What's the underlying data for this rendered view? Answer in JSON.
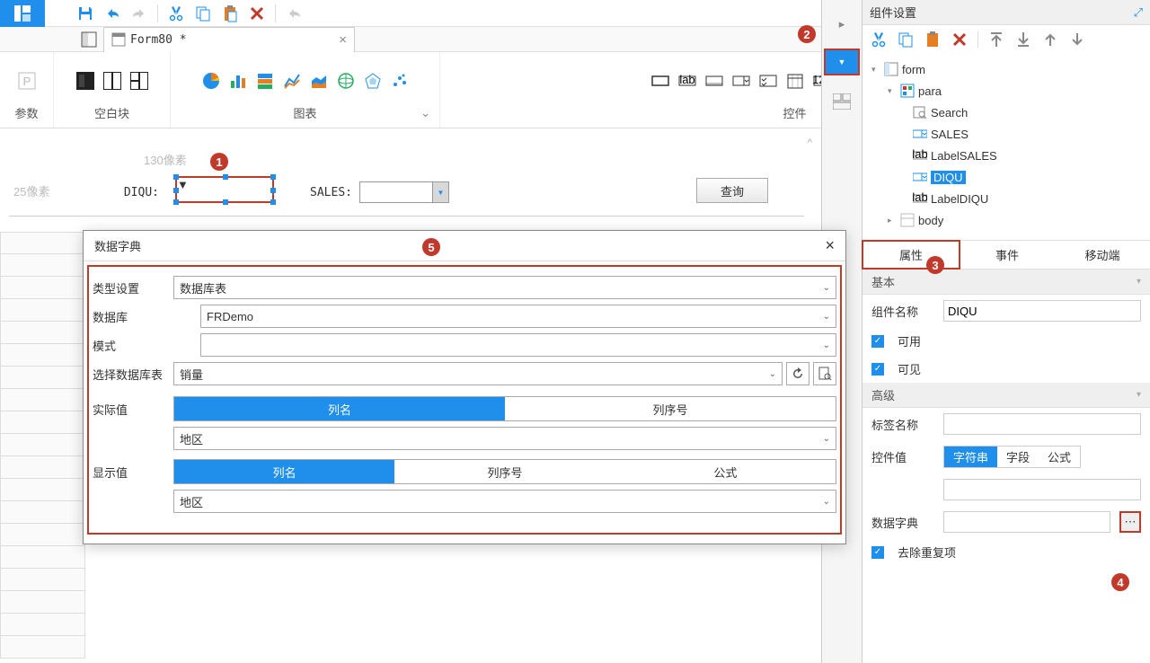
{
  "toolbar": {
    "save": "保存",
    "undo": "撤销",
    "redo": "重做",
    "cut": "剪切",
    "copy": "复制",
    "paste": "粘贴",
    "delete": "删除",
    "repeat": "格式刷"
  },
  "filetab": {
    "name": "Form80 *"
  },
  "params_label": "参数",
  "ribbon": {
    "blank": "空白块",
    "charts": "图表",
    "widgets": "控件"
  },
  "canvas": {
    "top_measure": "130像素",
    "left_measure": "25像素",
    "diqu_label": "DIQU:",
    "sales_label": "SALES:",
    "query_btn": "查询"
  },
  "annot": {
    "1": "1",
    "2": "2",
    "3": "3",
    "4": "4",
    "5": "5"
  },
  "rpanel": {
    "title": "组件设置",
    "tree": {
      "form": "form",
      "para": "para",
      "search": "Search",
      "sales": "SALES",
      "labelsales": "LabelSALES",
      "diqu": "DIQU",
      "labeldiqu": "LabelDIQU",
      "body": "body"
    },
    "tabs": {
      "attr": "属性",
      "event": "事件",
      "mobile": "移动端"
    },
    "section_basic": "基本",
    "comp_name_label": "组件名称",
    "comp_name_value": "DIQU",
    "enabled": "可用",
    "visible": "可见",
    "section_adv": "高级",
    "tag_label": "标签名称",
    "widget_value_label": "控件值",
    "seg": {
      "string": "字符串",
      "field": "字段",
      "formula": "公式"
    },
    "dict_label": "数据字典",
    "dedupe": "去除重复项"
  },
  "dialog": {
    "title": "数据字典",
    "type_label": "类型设置",
    "type_value": "数据库表",
    "db_label": "数据库",
    "db_value": "FRDemo",
    "schema_label": "模式",
    "schema_value": "",
    "table_label": "选择数据库表",
    "table_value": "销量",
    "actual_label": "实际值",
    "display_label": "显示值",
    "colname": "列名",
    "colidx": "列序号",
    "formula": "公式",
    "region": "地区"
  }
}
